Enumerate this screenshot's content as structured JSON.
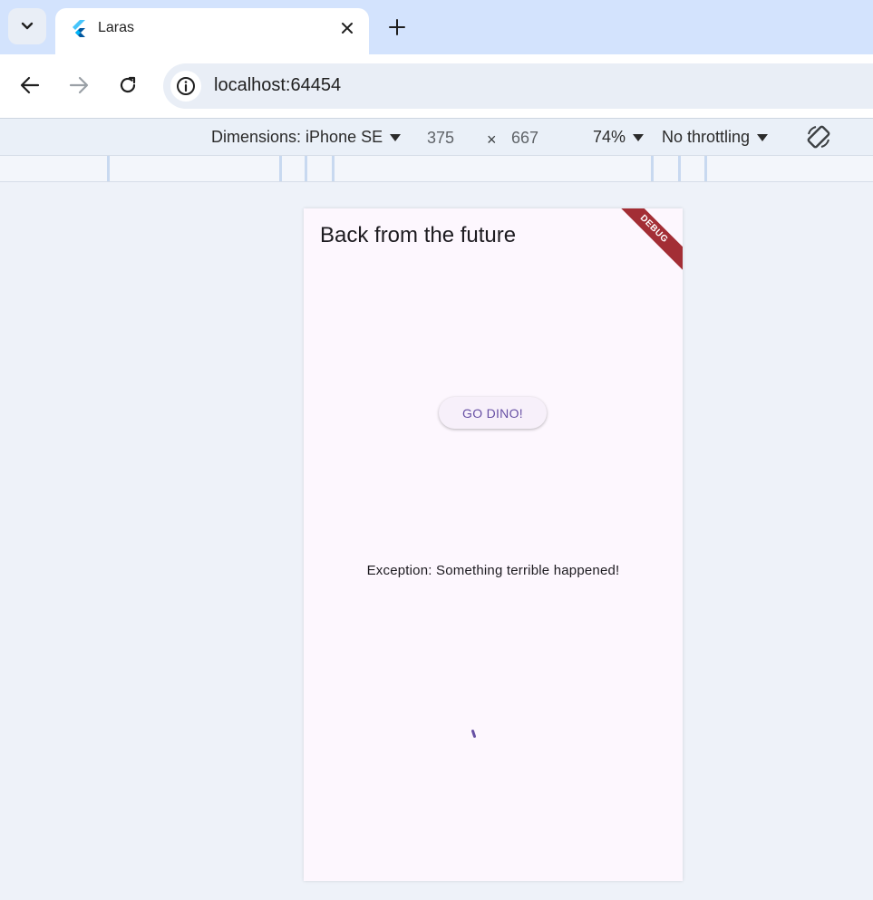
{
  "browser": {
    "tab": {
      "title": "Laras",
      "favicon": "flutter-logo"
    },
    "address": {
      "url": "localhost:64454"
    }
  },
  "device_toolbar": {
    "dimensions_label": "Dimensions: iPhone SE",
    "width": "375",
    "separator": "×",
    "height": "667",
    "zoom": "74%",
    "throttling": "No throttling"
  },
  "app": {
    "title": "Back from the future",
    "debug_banner": "DEBUG",
    "button_label": "GO DINO!",
    "exception_text": "Exception: Something terrible happened!",
    "accent_color": "#6750a4",
    "background_color": "#fdf7fe"
  }
}
